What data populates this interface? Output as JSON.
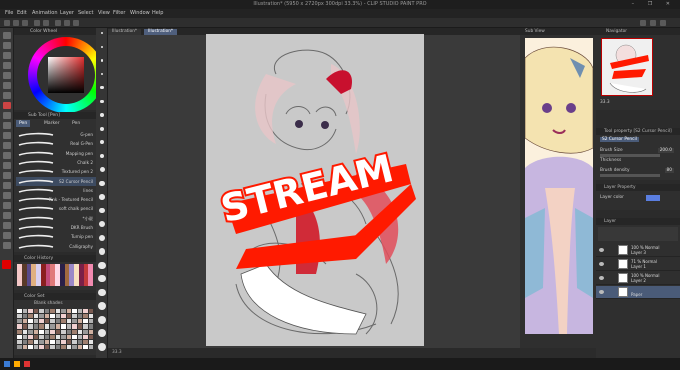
{
  "window": {
    "title": "Illustration* (5950 x 2720px 300dpi 33.3%)  - CLIP STUDIO PAINT PRO",
    "controls": "–  ❐  ✕"
  },
  "menu": {
    "items": [
      "File",
      "Edit",
      "Animation",
      "Layer",
      "Select",
      "View",
      "Filter",
      "Window",
      "Help"
    ]
  },
  "color_wheel": {
    "header": "Color Wheel",
    "readout": "205"
  },
  "sub_tool": {
    "header": "Sub Tool [Pen]",
    "tabs": [
      "Pen",
      "Marker",
      "Pen"
    ],
    "brushes": [
      {
        "label": "G-pen"
      },
      {
        "label": "Real G-Pen"
      },
      {
        "label": "Mapping pen"
      },
      {
        "label": "Chalk 2"
      },
      {
        "label": "Textured pen 2"
      },
      {
        "label": "S2 Cursor Pencil"
      },
      {
        "label": "lines"
      },
      {
        "label": "Pink - Textured Pencil"
      },
      {
        "label": "soft chalk pencil"
      },
      {
        "label": "*小说"
      },
      {
        "label": "DKR Brush"
      },
      {
        "label": "Turnip pen"
      },
      {
        "label": "Calligraphy"
      }
    ],
    "selected_index": 5
  },
  "color_set": {
    "header": "Color History"
  },
  "color_history": {
    "header": "Color Set",
    "subheader": "Blank shades"
  },
  "canvas": {
    "tabs": [
      "Illustration*",
      "Illustration*"
    ],
    "active_tab": 1,
    "stream_text": "STREAM",
    "status": "33.3"
  },
  "sub_view": {
    "header": "Sub View"
  },
  "navigator": {
    "header": "Navigator",
    "zoom": "33.3"
  },
  "tool_property": {
    "header": "Tool property [S2 Cursor Pencil]",
    "preset": "S2 Cursor Pencil",
    "brush_size_label": "Brush Size",
    "brush_size": "200.0",
    "thickness_label": "Thickness",
    "brush_density_label": "Brush density",
    "brush_density": "80"
  },
  "layer_property": {
    "header": "Layer Property",
    "layer_color_label": "Layer color"
  },
  "layers": {
    "header": "Layer",
    "rows": [
      {
        "line1": "100 % Normal",
        "line2": "Layer 3"
      },
      {
        "line1": "71 % Normal",
        "line2": "Layer 1"
      },
      {
        "line1": "100 % Normal",
        "line2": "Layer 2"
      },
      {
        "line1": "",
        "line2": "Paper"
      }
    ],
    "selected_index": 3
  },
  "colors": {
    "accent_blue": "#4a5b78",
    "main_color": "#e00000",
    "stroke_red": "#ff1a00"
  }
}
